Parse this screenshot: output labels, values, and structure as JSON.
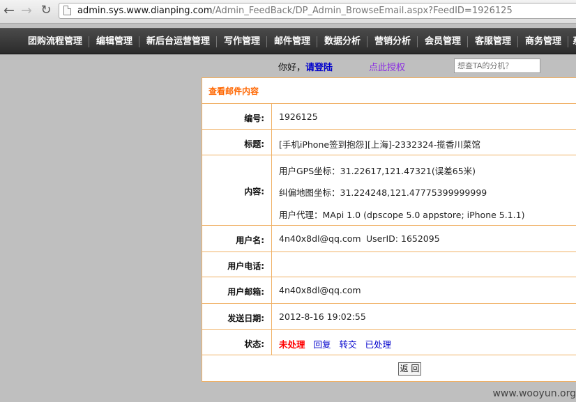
{
  "browser": {
    "url_host": "admin.sys.www.dianping.com",
    "url_path": "/Admin_FeedBack/DP_Admin_BrowseEmail.aspx?FeedID=1926125"
  },
  "nav": {
    "items": [
      {
        "label": "团购流程管理"
      },
      {
        "label": "编辑管理"
      },
      {
        "label": "新后台运营管理"
      },
      {
        "label": "写作管理"
      },
      {
        "label": "邮件管理"
      },
      {
        "label": "数据分析"
      },
      {
        "label": "营销分析"
      },
      {
        "label": "会员管理"
      },
      {
        "label": "客服管理"
      },
      {
        "label": "商务管理"
      },
      {
        "label": "系"
      }
    ]
  },
  "top": {
    "greeting": "你好，",
    "login_link": "请登陆",
    "authorize_link": "点此授权",
    "search_placeholder": "想查TA的分机？"
  },
  "panel": {
    "title": "查看邮件内容",
    "id_label": "编号:",
    "id_value": "1926125",
    "subject_label": "标题:",
    "subject_value": "[手机iPhone签到抱怨][上海]-2332324-揽香川菜馆",
    "content_label": "内容:",
    "content_lines": [
      "用户GPS坐标：31.22617,121.47321(误差65米)",
      "纠偏地图坐标：31.224248,121.47775399999999",
      "用户代理：MApi 1.0 (dpscope 5.0 appstore; iPhone 5.1.1)"
    ],
    "username_label": "用户名:",
    "username_value": "4n40x8dl@qq.com",
    "userid_value": "UserID: 1652095",
    "phone_label": "用户电话:",
    "phone_value": "",
    "email_label": "用户邮箱:",
    "email_value": "4n40x8dl@qq.com",
    "date_label": "发送日期:",
    "date_value": "2012-8-16 19:02:55",
    "status_label": "状态:",
    "status_current": "未处理",
    "status_actions": [
      "回复",
      "转交",
      "已处理"
    ],
    "return_button": "返 回"
  },
  "watermark": "www.wooyun.org"
}
